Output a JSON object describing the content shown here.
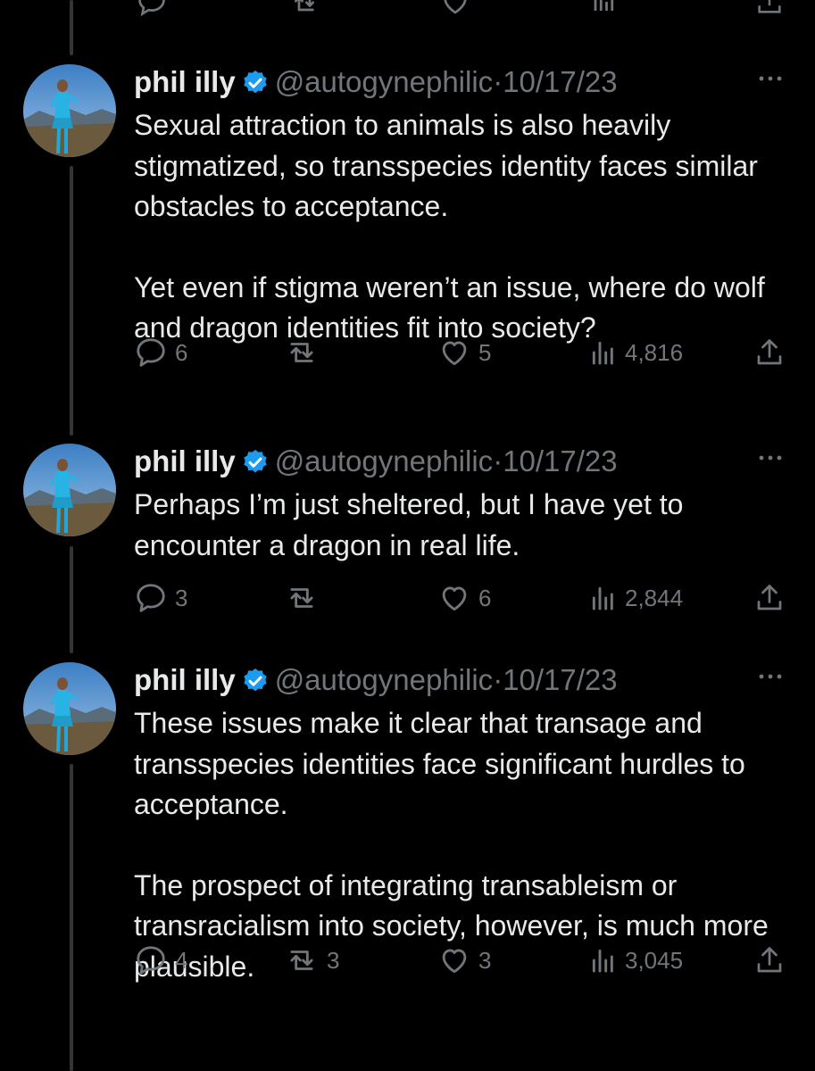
{
  "tweets": [
    {
      "name": "phil illy",
      "handle": "@autogynephilic",
      "separator": "·",
      "date": "10/17/23",
      "paragraphs": [
        "Sexual attraction to animals is also heavily stigmatized, so transspecies identity faces similar obstacles to acceptance.",
        "Yet even if stigma weren’t an issue, where do wolf and dragon identities fit into society?"
      ],
      "replies": "6",
      "retweets": "",
      "likes": "5",
      "views": "4,816"
    },
    {
      "name": "phil illy",
      "handle": "@autogynephilic",
      "separator": "·",
      "date": "10/17/23",
      "paragraphs": [
        "Perhaps I’m just sheltered, but I have yet to encounter a dragon in real life."
      ],
      "replies": "3",
      "retweets": "",
      "likes": "6",
      "views": "2,844"
    },
    {
      "name": "phil illy",
      "handle": "@autogynephilic",
      "separator": "·",
      "date": "10/17/23",
      "paragraphs": [
        "These issues make it clear that transage and transspecies identities face significant hurdles to acceptance.",
        "The prospect of integrating transableism or transracialism into society, however, is much more plausible."
      ],
      "replies": "4",
      "retweets": "3",
      "likes": "3",
      "views": "3,045"
    }
  ],
  "icons": {
    "verified_badge": "verified-badge-icon",
    "reply": "reply-icon",
    "retweet": "retweet-icon",
    "like": "heart-icon",
    "views": "views-icon",
    "share": "share-icon",
    "more": "more-icon"
  },
  "colors": {
    "background": "#000000",
    "text": "#e7e9ea",
    "muted": "#71767b",
    "verified": "#1d9bf0",
    "thread_line": "#333639"
  }
}
